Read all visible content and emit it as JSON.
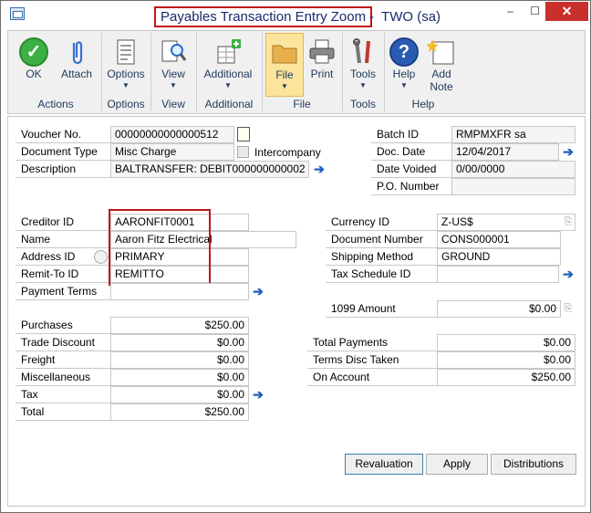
{
  "window": {
    "title": "Payables Transaction Entry Zoom",
    "title_suffix": "-  TWO (sa)",
    "min": "–",
    "max": "☐",
    "close": "✕"
  },
  "ribbon": {
    "ok": "OK",
    "attach": "Attach",
    "options": "Options",
    "view": "View",
    "additional": "Additional",
    "file": "File",
    "print": "Print",
    "tools": "Tools",
    "help": "Help",
    "add_note_1": "Add",
    "add_note_2": "Note",
    "groups": {
      "actions": "Actions",
      "options": "Options",
      "view": "View",
      "additional": "Additional",
      "file": "File",
      "tools": "Tools",
      "help": "Help"
    }
  },
  "form": {
    "voucher_no_label": "Voucher No.",
    "voucher_no": "00000000000000512",
    "document_type_label": "Document Type",
    "document_type": "Misc Charge",
    "intercompany_label": "Intercompany",
    "description_label": "Description",
    "description": "BALTRANSFER: DEBIT000000000002",
    "batch_id_label": "Batch ID",
    "batch_id": "RMPMXFR sa",
    "doc_date_label": "Doc. Date",
    "doc_date": "12/04/2017",
    "date_voided_label": "Date Voided",
    "date_voided": "0/00/0000",
    "po_number_label": "P.O. Number",
    "po_number": "",
    "creditor_id_label": "Creditor ID",
    "creditor_id": "AARONFIT0001",
    "name_label": "Name",
    "name": "Aaron Fitz Electrical",
    "address_id_label": "Address ID",
    "address_id": "PRIMARY",
    "remit_to_label": "Remit-To ID",
    "remit_to": "REMITTO",
    "payment_terms_label": "Payment Terms",
    "payment_terms": "",
    "currency_id_label": "Currency ID",
    "currency_id": "Z-US$",
    "document_number_label": "Document Number",
    "document_number": "CONS000001",
    "shipping_method_label": "Shipping Method",
    "shipping_method": "GROUND",
    "tax_schedule_label": "Tax Schedule ID",
    "tax_schedule": "",
    "amount_1099_label": "1099 Amount",
    "amount_1099": "$0.00",
    "purchases_label": "Purchases",
    "purchases": "$250.00",
    "trade_discount_label": "Trade Discount",
    "trade_discount": "$0.00",
    "freight_label": "Freight",
    "freight": "$0.00",
    "misc_label": "Miscellaneous",
    "misc": "$0.00",
    "tax_label": "Tax",
    "tax": "$0.00",
    "total_label": "Total",
    "total": "$250.00",
    "total_payments_label": "Total Payments",
    "total_payments": "$0.00",
    "terms_disc_label": "Terms Disc Taken",
    "terms_disc": "$0.00",
    "on_account_label": "On Account",
    "on_account": "$250.00"
  },
  "buttons": {
    "revaluation": "Revaluation",
    "apply": "Apply",
    "distributions": "Distributions"
  },
  "colors": {
    "highlight": "#c0161a",
    "nav_arrow": "#1f5fbf"
  }
}
